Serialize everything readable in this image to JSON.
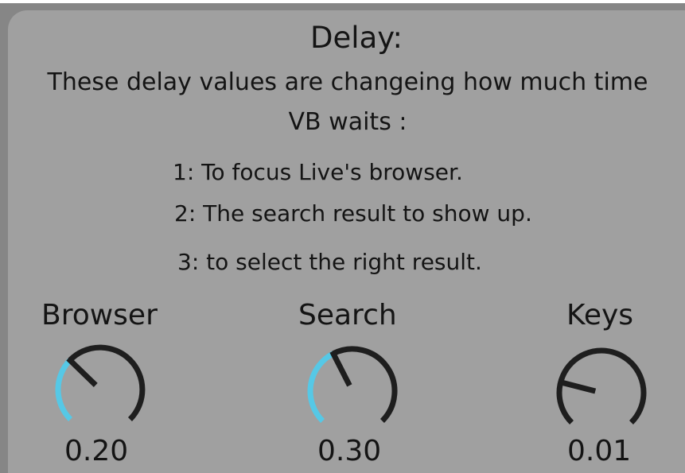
{
  "panel": {
    "title": "Delay:",
    "description_line1": "These delay values are changeing how much time",
    "description_line2": "VB waits :",
    "steps": [
      "1:  To focus Live's browser.",
      "2:  The search result to show up.",
      "3:  to select the right result."
    ]
  },
  "knobs": [
    {
      "label": "Browser",
      "value_text": "0.20",
      "value": 0.2
    },
    {
      "label": "Search",
      "value_text": "0.30",
      "value": 0.3
    },
    {
      "label": "Keys",
      "value_text": "0.01",
      "value": 0.01
    }
  ],
  "colors": {
    "panel_bg": "#a0a0a0",
    "outer_bg": "#868686",
    "text": "#141414",
    "knob_track": "#1e1e1e",
    "knob_fill": "#56c8e6"
  }
}
